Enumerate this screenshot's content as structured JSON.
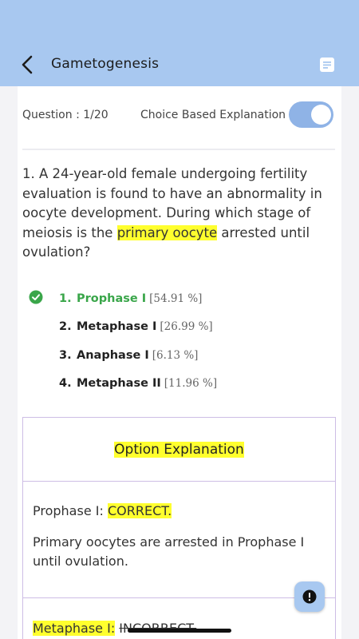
{
  "header": {
    "title": "Gametogenesis",
    "back_icon": "chevron-left-icon",
    "notes_icon": "notes-icon"
  },
  "question_header": {
    "count_label": "Question : 1/20",
    "toggle_label": "Choice Based Explanation",
    "toggle_on": true
  },
  "question": {
    "before": "1. A 24-year-old female undergoing fertility evaluation is found to have an abnormality in oocyte development. During which stage of meiosis is the ",
    "highlight": "primary oocyte",
    "after": " arrested until ovulation?"
  },
  "options": [
    {
      "num": "1.",
      "label": "Prophase I",
      "pct": "[54.91 %]",
      "correct": true
    },
    {
      "num": "2.",
      "label": "Metaphase I",
      "pct": "[26.99 %]",
      "correct": false
    },
    {
      "num": "3.",
      "label": "Anaphase I",
      "pct": "[6.13 %]",
      "correct": false
    },
    {
      "num": "4.",
      "label": "Metaphase II",
      "pct": "[11.96 %]",
      "correct": false
    }
  ],
  "explanation": {
    "title": "Option Explanation",
    "rows": [
      {
        "option": "Prophase I:",
        "verdict": "CORRECT.",
        "text": "Primary oocytes are arrested in Prophase I until ovulation."
      },
      {
        "option": "Metaphase I:",
        "verdict": "INCORRECT."
      }
    ]
  },
  "fab": {
    "icon": "alert-icon"
  },
  "colors": {
    "appbar": "#a8c8f0",
    "highlight": "#ffff2e",
    "correct": "#3aa64a",
    "toggle": "#8fb3e6",
    "border": "#cdbde5"
  }
}
